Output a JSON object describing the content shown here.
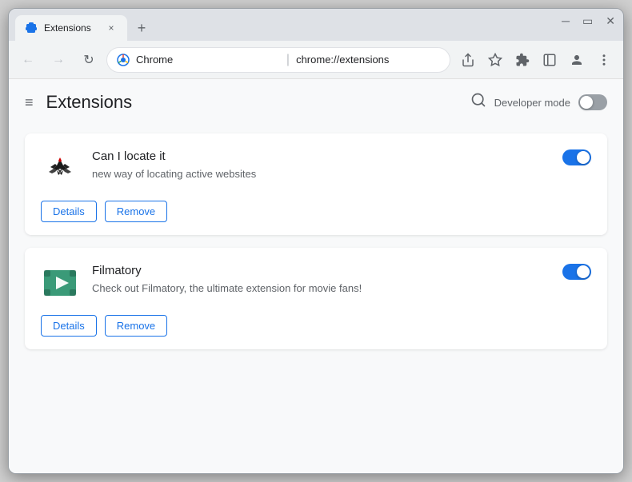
{
  "window": {
    "title": "Extensions",
    "tab_close": "×"
  },
  "tab": {
    "favicon_alt": "puzzle-icon",
    "title": "Extensions",
    "new_tab_label": "+"
  },
  "nav": {
    "back_icon": "←",
    "forward_icon": "→",
    "reload_icon": "↺",
    "chrome_label": "Chrome",
    "address": "chrome://extensions",
    "separator": "|",
    "share_icon": "⬆",
    "bookmark_icon": "☆",
    "extensions_icon": "⊞",
    "sidebar_icon": "▭",
    "profile_icon": "◉",
    "more_icon": "⋮"
  },
  "header": {
    "hamburger": "≡",
    "title": "Extensions",
    "search_icon": "🔍",
    "dev_mode_label": "Developer mode"
  },
  "extensions": [
    {
      "id": "can-i-locate-it",
      "name": "Can I locate it",
      "description": "new way of locating active websites",
      "enabled": true,
      "details_label": "Details",
      "remove_label": "Remove"
    },
    {
      "id": "filmatory",
      "name": "Filmatory",
      "description": "Check out Filmatory, the ultimate extension for movie fans!",
      "enabled": true,
      "details_label": "Details",
      "remove_label": "Remove"
    }
  ],
  "colors": {
    "accent": "#1a73e8",
    "toggle_on": "#1a73e8",
    "toggle_off": "#9aa0a6"
  }
}
